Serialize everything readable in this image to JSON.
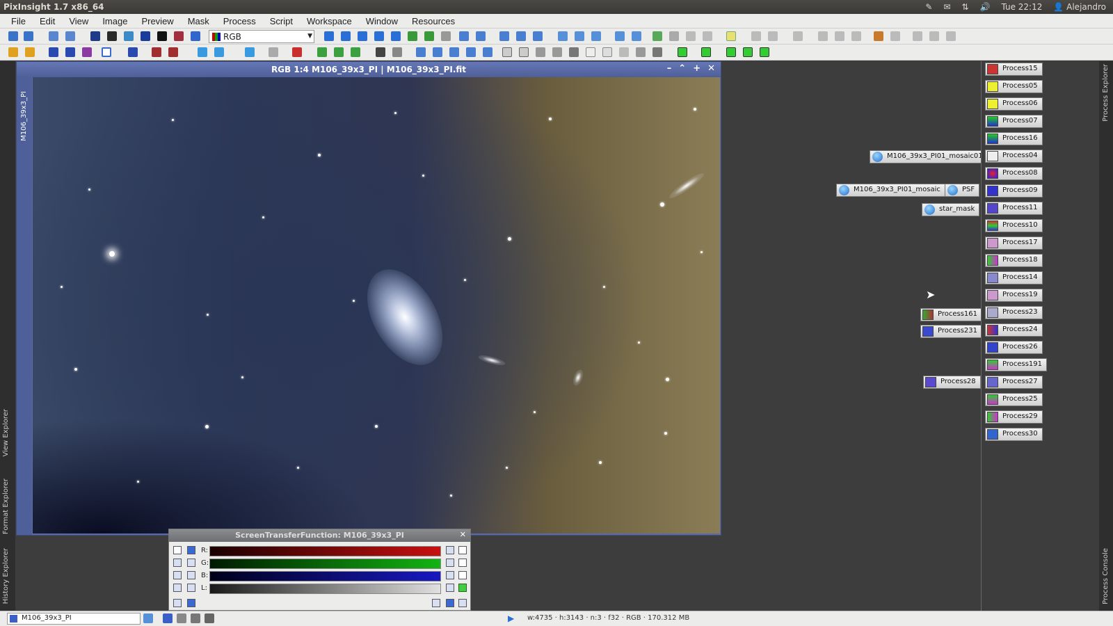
{
  "topbar": {
    "title": "PixInsight 1.7 x86_64",
    "clock": "Tue 22:12",
    "user": "Alejandro"
  },
  "menu": [
    "File",
    "Edit",
    "View",
    "Image",
    "Preview",
    "Mask",
    "Process",
    "Script",
    "Workspace",
    "Window",
    "Resources"
  ],
  "toolbar": {
    "channel_select": "RGB"
  },
  "image_window": {
    "title": "RGB 1:4 M106_39x3_PI | M106_39x3_PI.fit",
    "side_label": "M106_39x3_PI"
  },
  "stf": {
    "title": "ScreenTransferFunction: M106_39x3_PI",
    "channels": [
      "R:",
      "G:",
      "B:",
      "L:"
    ],
    "colors": {
      "r": "#c81010",
      "g": "#12b412",
      "b": "#1818c0",
      "l": "#e0e0e0"
    }
  },
  "left_tabs": {
    "view_explorer": "View Explorer",
    "format_explorer": "Format Explorer",
    "history_explorer": "History Explorer"
  },
  "right_tabs": {
    "process_explorer": "Process Explorer",
    "process_console": "Process Console"
  },
  "process_icons": [
    "Process15",
    "Process05",
    "Process06",
    "Process07",
    "Process16",
    "Process04",
    "Process08",
    "Process09",
    "Process11",
    "Process10",
    "Process17",
    "Process18",
    "Process14",
    "Process19",
    "Process23",
    "Process24",
    "Process26",
    "Process191",
    "Process27",
    "Process25",
    "Process29",
    "Process30"
  ],
  "loose_icons": {
    "mosaic01": "M106_39x3_PI01_mosaic01",
    "mosaic": "M106_39x3_PI01_mosaic",
    "psf": "PSF",
    "star_mask": "star_mask",
    "process161": "Process161",
    "process231": "Process231",
    "process28": "Process28"
  },
  "statusbar": {
    "view": "M106_39x3_PI",
    "info": "w:4735 · h:3143 · n:3 · f32 · RGB · 170.312 MB"
  }
}
